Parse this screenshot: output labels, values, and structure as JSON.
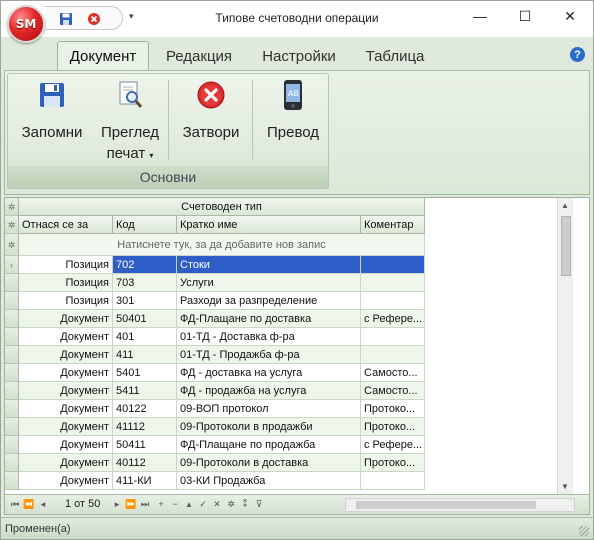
{
  "window": {
    "title": "Типове счетоводни операции",
    "app_badge": "SM"
  },
  "window_controls": {
    "minimize": "—",
    "maximize": "☐",
    "close": "✕"
  },
  "ribbon": {
    "tabs": [
      "Документ",
      "Редакция",
      "Настройки",
      "Таблица"
    ],
    "active_tab": 0,
    "group_label": "Основни",
    "buttons": {
      "save": "Запомни",
      "preview_line1": "Преглед",
      "preview_line2": "печат",
      "close": "Затвори",
      "translate": "Превод"
    }
  },
  "grid": {
    "band_title": "Счетоводен тип",
    "columns": [
      "Отнася се за",
      "Код",
      "Кратко име",
      "Коментар"
    ],
    "new_row_hint": "Натиснете тук, за да добавите нов запис",
    "rows": [
      {
        "ref": "Позиция",
        "code": "702",
        "name": "Стоки",
        "comment": ""
      },
      {
        "ref": "Позиция",
        "code": "703",
        "name": "Услуги",
        "comment": ""
      },
      {
        "ref": "Позиция",
        "code": "301",
        "name": "Разходи за разпределение",
        "comment": ""
      },
      {
        "ref": "Документ",
        "code": "50401",
        "name": "ФД-Плащане по доставка",
        "comment": "с Рефере..."
      },
      {
        "ref": "Документ",
        "code": "401",
        "name": "01-ТД - Доставка ф-ра",
        "comment": ""
      },
      {
        "ref": "Документ",
        "code": "411",
        "name": "01-ТД - Продажба ф-ра",
        "comment": ""
      },
      {
        "ref": "Документ",
        "code": "5401",
        "name": "ФД - доставка на услуга",
        "comment": "Самосто..."
      },
      {
        "ref": "Документ",
        "code": "5411",
        "name": "ФД - продажба на услуга",
        "comment": "Самосто..."
      },
      {
        "ref": "Документ",
        "code": "40122",
        "name": "09-ВОП протокол",
        "comment": "Протоко..."
      },
      {
        "ref": "Документ",
        "code": "41112",
        "name": "09-Протоколи в продажби",
        "comment": "Протоко..."
      },
      {
        "ref": "Документ",
        "code": "50411",
        "name": "ФД-Плащане по продажба",
        "comment": "с Рефере..."
      },
      {
        "ref": "Документ",
        "code": "40112",
        "name": "09-Протоколи в доставка",
        "comment": "Протоко..."
      },
      {
        "ref": "Документ",
        "code": "411-КИ",
        "name": "03-КИ Продажба",
        "comment": ""
      }
    ],
    "selected_row": 0
  },
  "navigator": {
    "page_indicator": "1 от 50"
  },
  "status": {
    "text": "Променен(а)"
  }
}
